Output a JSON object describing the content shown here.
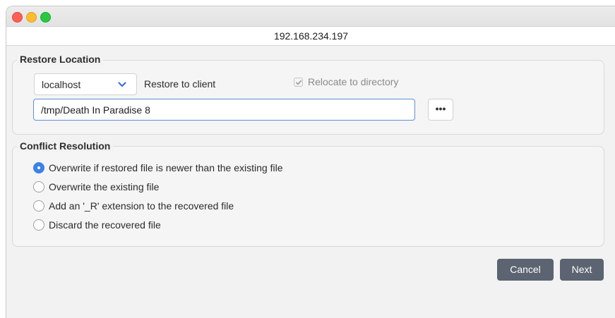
{
  "window": {
    "address": "192.168.234.197"
  },
  "restore_location": {
    "legend": "Restore Location",
    "client_select": {
      "value": "localhost",
      "icon": "chevron-down-icon",
      "accent": "#3b73d6"
    },
    "restore_to_client_label": "Restore to client",
    "relocate_checkbox": {
      "label": "Relocate to directory",
      "checked": true,
      "disabled": true
    },
    "path_input": {
      "value": "/tmp/Death In Paradise 8"
    },
    "browse_button": {
      "label": "•••"
    }
  },
  "conflict_resolution": {
    "legend": "Conflict Resolution",
    "options": [
      {
        "label": "Overwrite if restored file is newer than the existing file",
        "selected": true
      },
      {
        "label": "Overwrite the existing file",
        "selected": false
      },
      {
        "label": "Add an '_R' extension to the recovered file",
        "selected": false
      },
      {
        "label": "Discard the recovered file",
        "selected": false
      }
    ]
  },
  "footer": {
    "cancel_label": "Cancel",
    "next_label": "Next"
  },
  "colors": {
    "accent": "#3b82e8",
    "button_bg": "#5b6470",
    "traffic_red": "#ff5f57",
    "traffic_yellow": "#febc2e",
    "traffic_green": "#28c840"
  }
}
